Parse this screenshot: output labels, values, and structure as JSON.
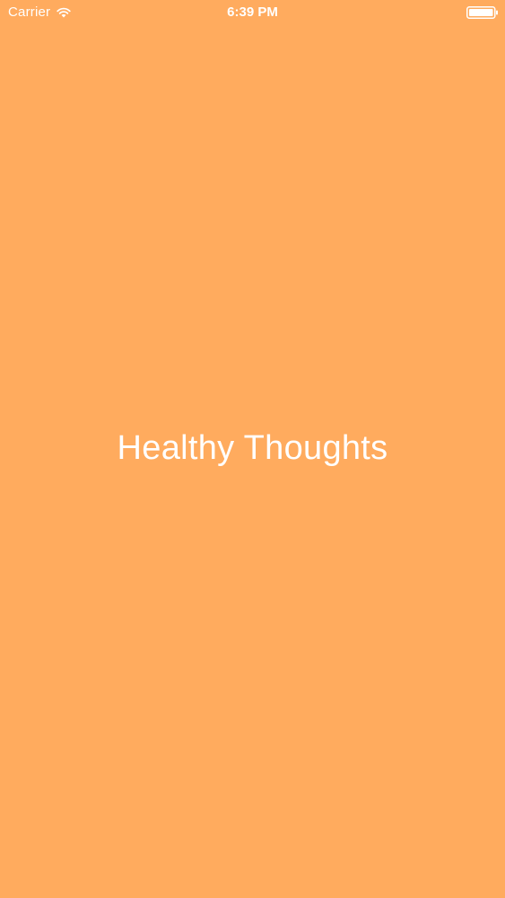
{
  "status_bar": {
    "carrier": "Carrier",
    "time": "6:39 PM",
    "wifi_icon": "wifi-icon",
    "battery_icon": "battery-icon"
  },
  "splash": {
    "title": "Healthy Thoughts"
  },
  "colors": {
    "background": "#FFAB5E",
    "text": "#FFFFFF"
  }
}
